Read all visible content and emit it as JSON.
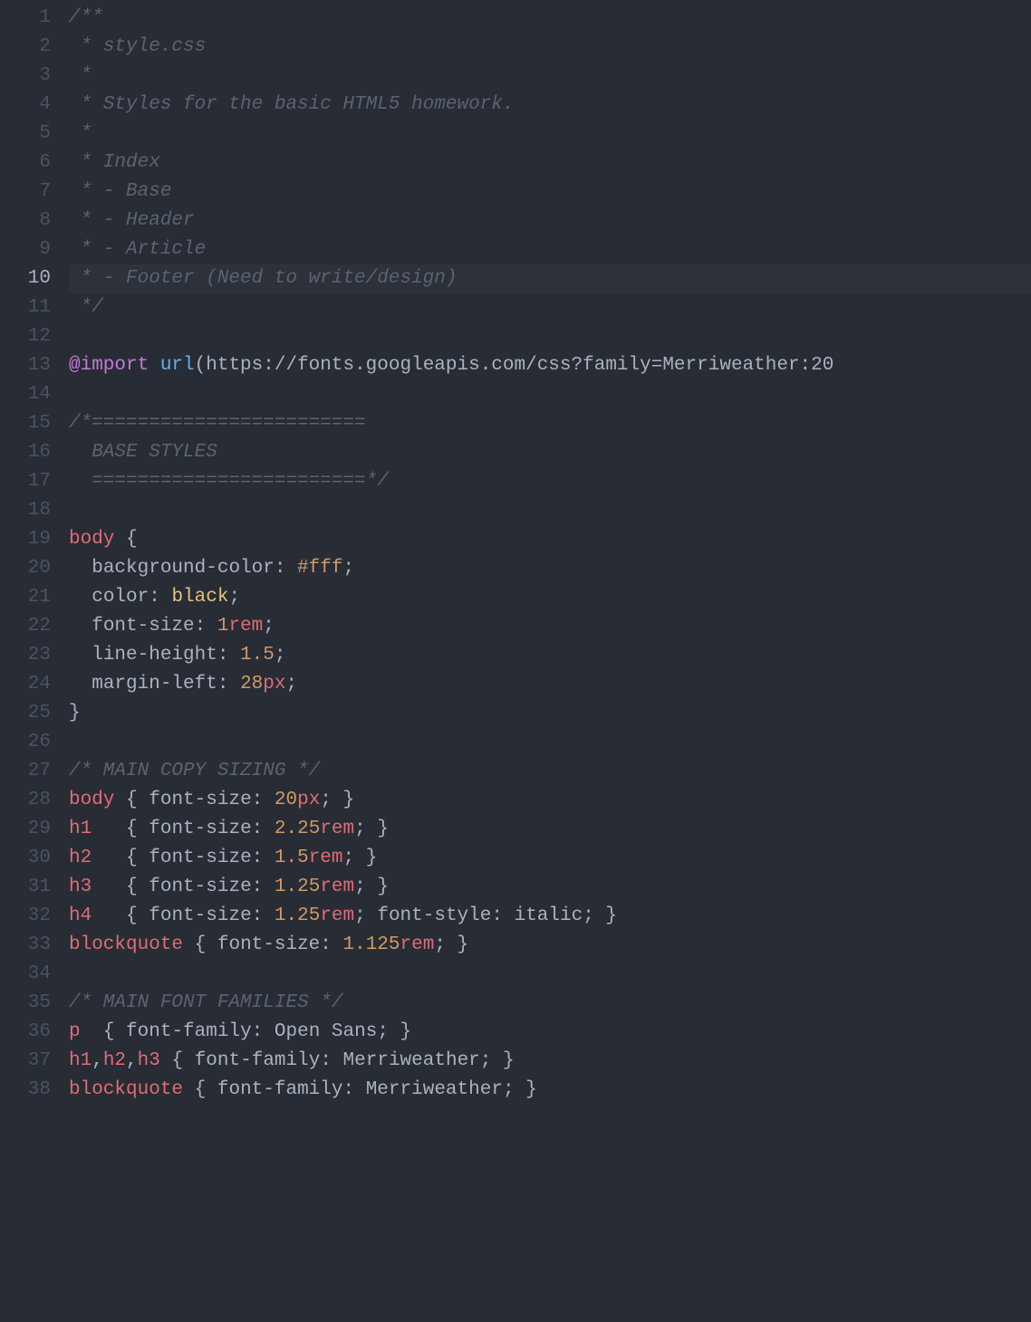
{
  "editor": {
    "current_line": 10,
    "lines": [
      {
        "num": 1,
        "tokens": [
          [
            "comment",
            "/**"
          ]
        ]
      },
      {
        "num": 2,
        "tokens": [
          [
            "comment",
            " * style.css"
          ]
        ]
      },
      {
        "num": 3,
        "tokens": [
          [
            "comment",
            " *"
          ]
        ]
      },
      {
        "num": 4,
        "tokens": [
          [
            "comment",
            " * Styles for the basic HTML5 homework."
          ]
        ]
      },
      {
        "num": 5,
        "tokens": [
          [
            "comment",
            " *"
          ]
        ]
      },
      {
        "num": 6,
        "tokens": [
          [
            "comment",
            " * Index"
          ]
        ]
      },
      {
        "num": 7,
        "tokens": [
          [
            "comment",
            " * - Base"
          ]
        ]
      },
      {
        "num": 8,
        "tokens": [
          [
            "comment",
            " * - Header"
          ]
        ]
      },
      {
        "num": 9,
        "tokens": [
          [
            "comment",
            " * - Article"
          ]
        ]
      },
      {
        "num": 10,
        "tokens": [
          [
            "comment",
            " * - Footer (Need to write/design)"
          ]
        ]
      },
      {
        "num": 11,
        "tokens": [
          [
            "comment",
            " */"
          ]
        ]
      },
      {
        "num": 12,
        "tokens": []
      },
      {
        "num": 13,
        "tokens": [
          [
            "keyword",
            "@import"
          ],
          [
            "default",
            " "
          ],
          [
            "func",
            "url"
          ],
          [
            "punc",
            "("
          ],
          [
            "default",
            "https://fonts.googleapis.com/css?family=Merriweather:20"
          ]
        ]
      },
      {
        "num": 14,
        "tokens": []
      },
      {
        "num": 15,
        "tokens": [
          [
            "comment",
            "/*========================"
          ]
        ]
      },
      {
        "num": 16,
        "tokens": [
          [
            "comment",
            "  BASE STYLES"
          ]
        ]
      },
      {
        "num": 17,
        "tokens": [
          [
            "comment",
            "  ========================*/"
          ]
        ]
      },
      {
        "num": 18,
        "tokens": []
      },
      {
        "num": 19,
        "tokens": [
          [
            "selector",
            "body"
          ],
          [
            "default",
            " "
          ],
          [
            "punc",
            "{"
          ]
        ]
      },
      {
        "num": 20,
        "tokens": [
          [
            "default",
            "  "
          ],
          [
            "property",
            "background-color"
          ],
          [
            "punc",
            ": "
          ],
          [
            "number",
            "#fff"
          ],
          [
            "punc",
            ";"
          ]
        ]
      },
      {
        "num": 21,
        "tokens": [
          [
            "default",
            "  "
          ],
          [
            "property",
            "color"
          ],
          [
            "punc",
            ": "
          ],
          [
            "builtin",
            "black"
          ],
          [
            "punc",
            ";"
          ]
        ]
      },
      {
        "num": 22,
        "tokens": [
          [
            "default",
            "  "
          ],
          [
            "property",
            "font-size"
          ],
          [
            "punc",
            ": "
          ],
          [
            "number",
            "1"
          ],
          [
            "unit",
            "rem"
          ],
          [
            "punc",
            ";"
          ]
        ]
      },
      {
        "num": 23,
        "tokens": [
          [
            "default",
            "  "
          ],
          [
            "property",
            "line-height"
          ],
          [
            "punc",
            ": "
          ],
          [
            "number",
            "1.5"
          ],
          [
            "punc",
            ";"
          ]
        ]
      },
      {
        "num": 24,
        "tokens": [
          [
            "default",
            "  "
          ],
          [
            "property",
            "margin-left"
          ],
          [
            "punc",
            ": "
          ],
          [
            "number",
            "28"
          ],
          [
            "unit",
            "px"
          ],
          [
            "punc",
            ";"
          ]
        ]
      },
      {
        "num": 25,
        "tokens": [
          [
            "punc",
            "}"
          ]
        ]
      },
      {
        "num": 26,
        "tokens": []
      },
      {
        "num": 27,
        "tokens": [
          [
            "comment",
            "/* MAIN COPY SIZING */"
          ]
        ]
      },
      {
        "num": 28,
        "tokens": [
          [
            "selector",
            "body"
          ],
          [
            "default",
            " "
          ],
          [
            "punc",
            "{"
          ],
          [
            "default",
            " "
          ],
          [
            "property",
            "font-size"
          ],
          [
            "punc",
            ": "
          ],
          [
            "number",
            "20"
          ],
          [
            "unit",
            "px"
          ],
          [
            "punc",
            "; }"
          ]
        ]
      },
      {
        "num": 29,
        "tokens": [
          [
            "selector",
            "h1"
          ],
          [
            "default",
            "   "
          ],
          [
            "punc",
            "{"
          ],
          [
            "default",
            " "
          ],
          [
            "property",
            "font-size"
          ],
          [
            "punc",
            ": "
          ],
          [
            "number",
            "2.25"
          ],
          [
            "unit",
            "rem"
          ],
          [
            "punc",
            "; }"
          ]
        ]
      },
      {
        "num": 30,
        "tokens": [
          [
            "selector",
            "h2"
          ],
          [
            "default",
            "   "
          ],
          [
            "punc",
            "{"
          ],
          [
            "default",
            " "
          ],
          [
            "property",
            "font-size"
          ],
          [
            "punc",
            ": "
          ],
          [
            "number",
            "1.5"
          ],
          [
            "unit",
            "rem"
          ],
          [
            "punc",
            "; }"
          ]
        ]
      },
      {
        "num": 31,
        "tokens": [
          [
            "selector",
            "h3"
          ],
          [
            "default",
            "   "
          ],
          [
            "punc",
            "{"
          ],
          [
            "default",
            " "
          ],
          [
            "property",
            "font-size"
          ],
          [
            "punc",
            ": "
          ],
          [
            "number",
            "1.25"
          ],
          [
            "unit",
            "rem"
          ],
          [
            "punc",
            "; }"
          ]
        ]
      },
      {
        "num": 32,
        "tokens": [
          [
            "selector",
            "h4"
          ],
          [
            "default",
            "   "
          ],
          [
            "punc",
            "{"
          ],
          [
            "default",
            " "
          ],
          [
            "property",
            "font-size"
          ],
          [
            "punc",
            ": "
          ],
          [
            "number",
            "1.25"
          ],
          [
            "unit",
            "rem"
          ],
          [
            "punc",
            "; "
          ],
          [
            "property",
            "font-style"
          ],
          [
            "punc",
            ": "
          ],
          [
            "default",
            "italic"
          ],
          [
            "punc",
            "; }"
          ]
        ]
      },
      {
        "num": 33,
        "tokens": [
          [
            "selector",
            "blockquote"
          ],
          [
            "default",
            " "
          ],
          [
            "punc",
            "{"
          ],
          [
            "default",
            " "
          ],
          [
            "property",
            "font-size"
          ],
          [
            "punc",
            ": "
          ],
          [
            "number",
            "1.125"
          ],
          [
            "unit",
            "rem"
          ],
          [
            "punc",
            "; }"
          ]
        ]
      },
      {
        "num": 34,
        "tokens": []
      },
      {
        "num": 35,
        "tokens": [
          [
            "comment",
            "/* MAIN FONT FAMILIES */"
          ]
        ]
      },
      {
        "num": 36,
        "tokens": [
          [
            "selector",
            "p"
          ],
          [
            "default",
            "  "
          ],
          [
            "punc",
            "{"
          ],
          [
            "default",
            " "
          ],
          [
            "property",
            "font-family"
          ],
          [
            "punc",
            ": "
          ],
          [
            "default",
            "Open Sans"
          ],
          [
            "punc",
            "; }"
          ]
        ]
      },
      {
        "num": 37,
        "tokens": [
          [
            "selector",
            "h1"
          ],
          [
            "punc",
            ","
          ],
          [
            "selector",
            "h2"
          ],
          [
            "punc",
            ","
          ],
          [
            "selector",
            "h3"
          ],
          [
            "default",
            " "
          ],
          [
            "punc",
            "{"
          ],
          [
            "default",
            " "
          ],
          [
            "property",
            "font-family"
          ],
          [
            "punc",
            ": "
          ],
          [
            "default",
            "Merriweather"
          ],
          [
            "punc",
            "; }"
          ]
        ]
      },
      {
        "num": 38,
        "tokens": [
          [
            "selector",
            "blockquote"
          ],
          [
            "default",
            " "
          ],
          [
            "punc",
            "{"
          ],
          [
            "default",
            " "
          ],
          [
            "property",
            "font-family"
          ],
          [
            "punc",
            ": "
          ],
          [
            "default",
            "Merriweather"
          ],
          [
            "punc",
            "; }"
          ]
        ]
      }
    ]
  }
}
